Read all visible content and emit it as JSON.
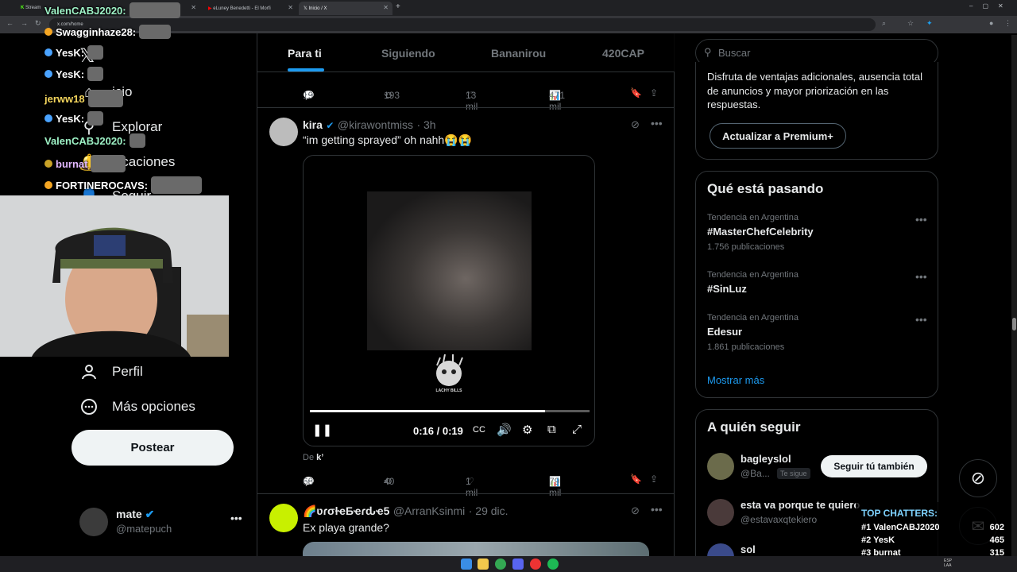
{
  "browser": {
    "tabs": [
      {
        "label": "Stream"
      },
      {
        "label": "eLuney Benedetti - El Morfi"
      },
      {
        "label": "Inicio / X"
      }
    ],
    "url": "x.com/home"
  },
  "sidebar": {
    "items": [
      {
        "label": "Inicio",
        "icon": "home-icon"
      },
      {
        "label": "Explorar",
        "icon": "search-icon"
      },
      {
        "label": "Notificaciones",
        "icon": "bell-icon"
      },
      {
        "label": "Seguir",
        "icon": "person-add-icon"
      },
      {
        "label": "Perfil",
        "icon": "person-icon"
      },
      {
        "label": "Más opciones",
        "icon": "more-circle-icon"
      }
    ],
    "visible_labels": {
      "inicio": "icio",
      "explorar": "Explorar",
      "notificaciones": "ificaciones",
      "seguir": "Seguir"
    },
    "post_button": "Postear",
    "profile": {
      "name": "mate",
      "handle": "@matepuch"
    }
  },
  "chat": [
    {
      "user": "ValenCABJ2020:",
      "color": "#9ef2c6"
    },
    {
      "user": "Swagginhaze28:",
      "color": "#ffffff"
    },
    {
      "user": "YesK:",
      "color": "#ffffff"
    },
    {
      "user": "YesK:",
      "color": "#ffffff"
    },
    {
      "user": "jerww18",
      "color": "#f2d45c"
    },
    {
      "user": "YesK:",
      "color": "#ffffff"
    },
    {
      "user": "ValenCABJ2020:",
      "color": "#9ef2c6"
    },
    {
      "user": "burnat",
      "color": "#e2b8ff"
    },
    {
      "user": "FORTINEROCAVS:",
      "color": "#ffffff"
    }
  ],
  "feed": {
    "tabs": [
      "Para ti",
      "Siguiendo",
      "Bananirou",
      "420CAP"
    ],
    "prev_actions": {
      "replies": "19",
      "reposts": "193",
      "likes": "13 mil",
      "views": "471 mil"
    },
    "tweet": {
      "name": "kira",
      "handle": "@kirawontmiss",
      "time": "· 3h",
      "text": "“im getting sprayed” oh nahh😭😭",
      "video_time": "0:16 / 0:19",
      "video_progress": 0.84,
      "video_watermark": "LACHY BILLS",
      "from_label": "De",
      "from_name": "k’",
      "actions": {
        "replies": "68",
        "reposts": "40",
        "likes": "1 mil",
        "views": "79 mil"
      }
    },
    "tweet2": {
      "name": "🌈ʋɾσƚҽƂҽɾԃҽ5",
      "handle": "@ArranKsinmi",
      "time": "· 29 dic.",
      "text": "Ex playa grande?"
    }
  },
  "right": {
    "search_placeholder": "Buscar",
    "premium": {
      "text": "Disfruta de ventajas adicionales, ausencia total de anuncios y mayor priorización en las respuestas.",
      "button": "Actualizar a Premium+"
    },
    "trends_title": "Qué está pasando",
    "trends": [
      {
        "category": "Tendencia en Argentina",
        "name": "#MasterChefCelebrity",
        "count": "1.756 publicaciones"
      },
      {
        "category": "Tendencia en Argentina",
        "name": "#SinLuz",
        "count": ""
      },
      {
        "category": "Tendencia en Argentina",
        "name": "Edesur",
        "count": "1.861 publicaciones"
      }
    ],
    "show_more": "Mostrar más",
    "follow_title": "A quién seguir",
    "follow": [
      {
        "name": "bagleyslol",
        "handle": "@Ba...",
        "badge": "Te sigue",
        "button": "Seguir tú también"
      },
      {
        "name": "esta va porque te quiero",
        "handle": "@estavaxqtekiero",
        "button": "Seguir"
      },
      {
        "name": "sol",
        "handle": ""
      }
    ]
  },
  "top_chatters": {
    "title": "TOP CHATTERS:",
    "rows": [
      {
        "rank": "#1",
        "name": "ValenCABJ2020",
        "count": "602"
      },
      {
        "rank": "#2",
        "name": "YesK",
        "count": "465"
      },
      {
        "rank": "#3",
        "name": "burnat",
        "count": "315"
      }
    ]
  },
  "taskbar": {
    "lang": "ESP LAA"
  },
  "colors": {
    "accent": "#1d9bf0",
    "border": "#2f3336",
    "muted": "#71767b"
  }
}
